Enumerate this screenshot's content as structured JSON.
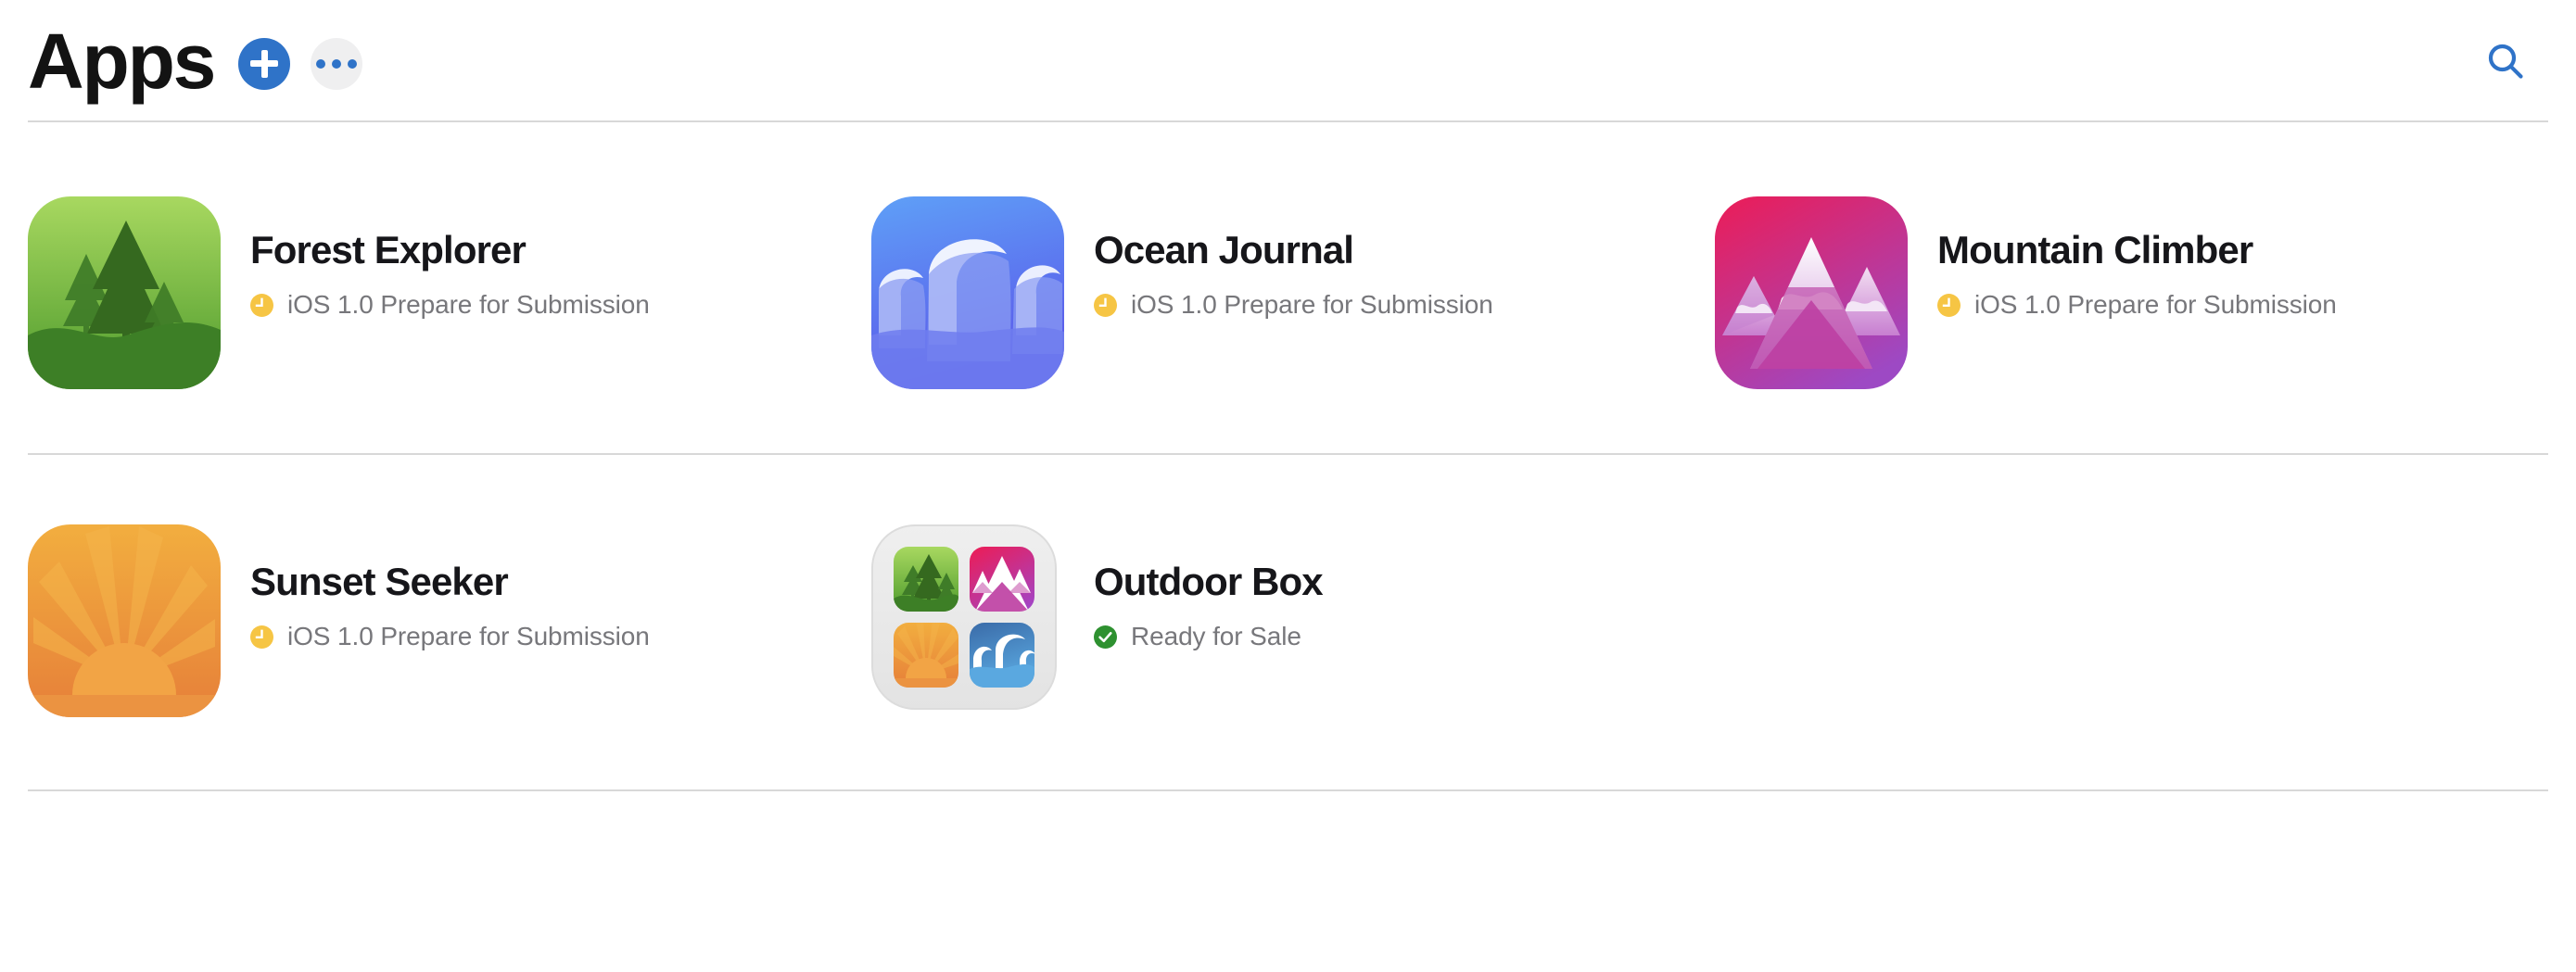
{
  "header": {
    "title": "Apps",
    "add_label": "Add App",
    "more_label": "More Options",
    "search_label": "Search",
    "accent_color": "#2f73c8",
    "more_bg_color": "#efeff0"
  },
  "status_colors": {
    "prepare_for_submission": "#f6c544",
    "ready_for_sale": "#2e9130"
  },
  "apps": [
    {
      "name": "Forest Explorer",
      "status": "iOS 1.0 Prepare for Submission",
      "status_icon": "clock-icon",
      "icon": "forest-icon",
      "icon_colors": {
        "top": "#a4d65e",
        "bottom": "#4e9a2f"
      }
    },
    {
      "name": "Ocean Journal",
      "status": "iOS 1.0 Prepare for Submission",
      "status_icon": "clock-icon",
      "icon": "ocean-icon",
      "icon_colors": {
        "top": "#5b9bf5",
        "bottom": "#5b5bea"
      }
    },
    {
      "name": "Mountain Climber",
      "status": "iOS 1.0 Prepare for Submission",
      "status_icon": "clock-icon",
      "icon": "mountain-icon",
      "icon_colors": {
        "top": "#e7215f",
        "bottom": "#b5399c"
      }
    },
    {
      "name": "Sunset Seeker",
      "status": "iOS 1.0 Prepare for Submission",
      "status_icon": "clock-icon",
      "icon": "sunset-icon",
      "icon_colors": {
        "top": "#f0a93c",
        "bottom": "#e8813a"
      }
    },
    {
      "name": "Outdoor Box",
      "status": "Ready for Sale",
      "status_icon": "check-circle-icon",
      "icon": "app-bundle-icon",
      "icon_colors": {
        "top": "#ededed",
        "bottom": "#e4e4e4"
      }
    }
  ]
}
